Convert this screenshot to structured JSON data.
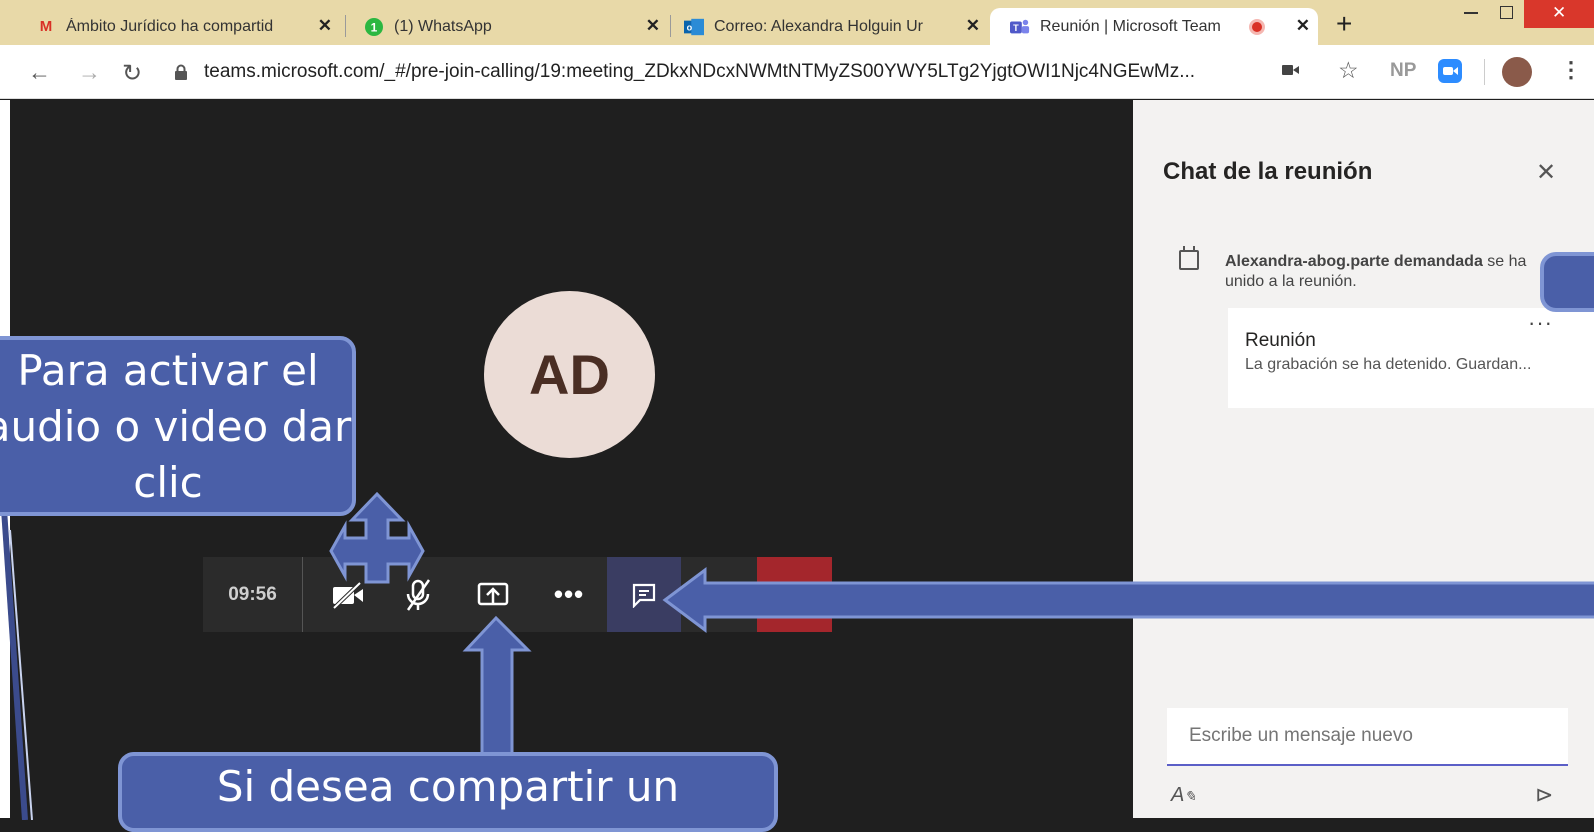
{
  "browser": {
    "tabs": [
      {
        "title": "Ámbito Jurídico ha compartid",
        "favicon": "gmail-icon",
        "active": false
      },
      {
        "title": "(1) WhatsApp",
        "favicon": "whatsapp-icon",
        "active": false
      },
      {
        "title": "Correo: Alexandra Holguin Ur",
        "favicon": "outlook-icon",
        "active": false
      },
      {
        "title": "Reunión | Microsoft Team",
        "favicon": "teams-icon",
        "active": true
      }
    ],
    "new_tab": "+",
    "url": "teams.microsoft.com/_#/pre-join-calling/19:meeting_ZDkxNDcxNWMtNTMyZS00YWY5LTg2YjgtOWI1Njc4NGEwMz...",
    "profile_initials": "NP"
  },
  "meeting": {
    "avatar_initials": "AD",
    "timer": "09:56"
  },
  "chat_panel": {
    "title": "Chat de la reunión",
    "join_user": "Alexandra-abog.parte demandada",
    "join_text": " se ha unido a la reunión.",
    "card_title": "Reunión",
    "card_text": "La grabación se ha detenido. Guardan...",
    "card_more": "···",
    "input_placeholder": "Escribe un mensaje nuevo"
  },
  "annotations": {
    "callout_audio_video": "Para activar el audio o video dar clic",
    "callout_share": "Si desea compartir un"
  },
  "colors": {
    "accent": "#5b5fc7",
    "hangup": "#a4262c",
    "callout_fill": "#4a5fa8",
    "callout_border": "#7f95d4",
    "tabbar": "#e8d9a8"
  }
}
